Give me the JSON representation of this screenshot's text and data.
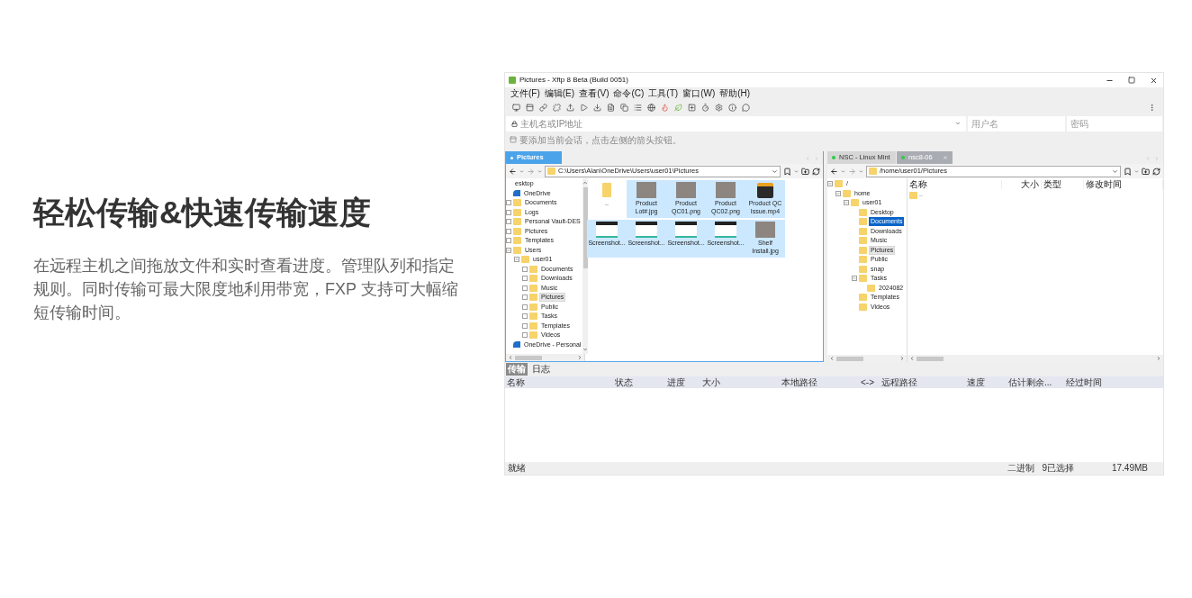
{
  "heading": "轻松传输&快速传输速度",
  "description": "在远程主机之间拖放文件和实时查看进度。管理队列和指定规则。同时传输可最大限度地利用带宽，FXP 支持可大幅缩短传输时间。",
  "window": {
    "title": "Pictures - Xftp 8 Beta (Build 0051)"
  },
  "menu": [
    "文件(F)",
    "编辑(E)",
    "查看(V)",
    "命令(C)",
    "工具(T)",
    "窗口(W)",
    "帮助(H)"
  ],
  "connection": {
    "host_placeholder": "主机名或IP地址",
    "user_placeholder": "用户名",
    "password_placeholder": "密码"
  },
  "hint": "要添加当前会话，点击左侧的箭头按钮。",
  "local": {
    "tabs": [
      {
        "label": "Pictures",
        "selected": true
      }
    ],
    "path": "C:\\Users\\Alan\\OneDrive\\Users\\user01\\Pictures",
    "tree": [
      {
        "label": "esktop",
        "kind": "plain",
        "selected": false,
        "current": false
      },
      {
        "label": "OneDrive",
        "kind": "cloud",
        "selected": false,
        "current": false
      },
      {
        "label": "Documents",
        "kind": "folder",
        "expanded": false,
        "selected": false,
        "current": false
      },
      {
        "label": "Logs",
        "kind": "folder",
        "expanded": false,
        "selected": false,
        "current": false
      },
      {
        "label": "Personal Vault-DES",
        "kind": "folder",
        "expanded": false,
        "selected": false,
        "current": false
      },
      {
        "label": "Pictures",
        "kind": "folder",
        "expanded": false,
        "selected": false,
        "current": false
      },
      {
        "label": "Templates",
        "kind": "folder",
        "expanded": false,
        "selected": false,
        "current": false
      },
      {
        "label": "Users",
        "kind": "folder",
        "expanded": true,
        "selected": false,
        "current": false,
        "children": [
          {
            "label": "user01",
            "kind": "folder",
            "expanded": true,
            "selected": false,
            "current": false,
            "children": [
              {
                "label": "Documents",
                "kind": "folder",
                "expanded": false,
                "selected": false,
                "current": false
              },
              {
                "label": "Downloads",
                "kind": "folder",
                "expanded": false,
                "selected": false,
                "current": false
              },
              {
                "label": "Music",
                "kind": "folder",
                "expanded": false,
                "selected": false,
                "current": false
              },
              {
                "label": "Pictures",
                "kind": "folder",
                "expanded": false,
                "selected": false,
                "current": true
              },
              {
                "label": "Public",
                "kind": "folder",
                "expanded": false,
                "selected": false,
                "current": false
              },
              {
                "label": "Tasks",
                "kind": "folder",
                "expanded": false,
                "selected": false,
                "current": false
              },
              {
                "label": "Templates",
                "kind": "folder",
                "expanded": false,
                "selected": false,
                "current": false
              },
              {
                "label": "Videos",
                "kind": "folder",
                "expanded": false,
                "selected": false,
                "current": false
              }
            ]
          }
        ]
      },
      {
        "label": "OneDrive - Personal",
        "kind": "cloud",
        "selected": false,
        "current": false
      }
    ],
    "files": [
      {
        "name": "..",
        "kind": "folder",
        "selected": false
      },
      {
        "name": "Product Lot#.jpg",
        "kind": "photo",
        "selected": true
      },
      {
        "name": "Product QC01.png",
        "kind": "photo",
        "selected": true
      },
      {
        "name": "Product QC02.png",
        "kind": "photo",
        "selected": true
      },
      {
        "name": "Product QC Issue.mp4",
        "kind": "video",
        "selected": true
      },
      {
        "name": "Screenshot...",
        "kind": "screenshot",
        "selected": true
      },
      {
        "name": "Screenshot...",
        "kind": "screenshot",
        "selected": true
      },
      {
        "name": "Screenshot...",
        "kind": "screenshot",
        "selected": true
      },
      {
        "name": "Screenshot...",
        "kind": "screenshot",
        "selected": true
      },
      {
        "name": "Shelf Install.jpg",
        "kind": "photo",
        "selected": true
      }
    ]
  },
  "remote": {
    "tabs": [
      {
        "label": "NSC - Linux Mint",
        "selected": false
      },
      {
        "label": "nsc8-06",
        "selected": true
      }
    ],
    "path": "/home/user01/Pictures",
    "tree": [
      {
        "label": "/",
        "kind": "folder",
        "expanded": true,
        "selected": false,
        "current": false,
        "children": [
          {
            "label": "home",
            "kind": "folder",
            "expanded": true,
            "selected": false,
            "current": false,
            "children": [
              {
                "label": "user01",
                "kind": "folder",
                "expanded": true,
                "selected": false,
                "current": false,
                "children": [
                  {
                    "label": "Desktop",
                    "kind": "folder",
                    "selected": false,
                    "current": false
                  },
                  {
                    "label": "Documents",
                    "kind": "folder",
                    "selected": true,
                    "current": false
                  },
                  {
                    "label": "Downloads",
                    "kind": "folder",
                    "selected": false,
                    "current": false
                  },
                  {
                    "label": "Music",
                    "kind": "folder",
                    "selected": false,
                    "current": false
                  },
                  {
                    "label": "Pictures",
                    "kind": "folder",
                    "selected": false,
                    "current": true
                  },
                  {
                    "label": "Public",
                    "kind": "folder",
                    "selected": false,
                    "current": false
                  },
                  {
                    "label": "snap",
                    "kind": "folder",
                    "selected": false,
                    "current": false
                  },
                  {
                    "label": "Tasks",
                    "kind": "folder",
                    "expanded": true,
                    "selected": false,
                    "current": false,
                    "children": [
                      {
                        "label": "2024082",
                        "kind": "folder",
                        "selected": false,
                        "current": false
                      }
                    ]
                  },
                  {
                    "label": "Templates",
                    "kind": "folder",
                    "selected": false,
                    "current": false
                  },
                  {
                    "label": "Videos",
                    "kind": "folder",
                    "selected": false,
                    "current": false
                  }
                ]
              }
            ]
          }
        ]
      }
    ],
    "columns": [
      "名称",
      "大小",
      "类型",
      "修改时间"
    ],
    "rows": [
      {
        "name": ".."
      }
    ]
  },
  "bottom_tabs": [
    {
      "label": "传输",
      "selected": true
    },
    {
      "label": "日志",
      "selected": false
    }
  ],
  "transfer_columns": [
    "名称",
    "状态",
    "进度",
    "大小",
    "本地路径",
    "<->",
    "远程路径",
    "速度",
    "估计剩余...",
    "经过时间"
  ],
  "status_bar": {
    "left": "就绪",
    "items": [
      "二进制",
      "9已选择",
      "17.49MB"
    ]
  }
}
